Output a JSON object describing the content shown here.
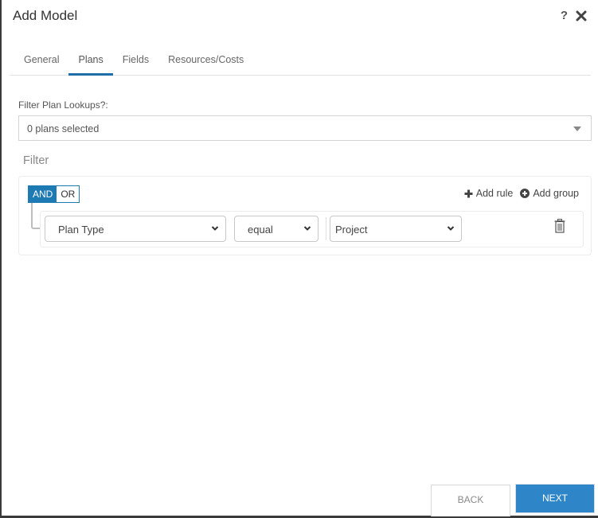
{
  "dialog": {
    "title": "Add Model",
    "help_label": "?",
    "close_icon": "close-icon"
  },
  "tabs": [
    {
      "label": "General",
      "active": false
    },
    {
      "label": "Plans",
      "active": true
    },
    {
      "label": "Fields",
      "active": false
    },
    {
      "label": "Resources/Costs",
      "active": false
    }
  ],
  "lookup": {
    "label": "Filter Plan Lookups?:",
    "value": "0 plans selected"
  },
  "filter": {
    "heading": "Filter",
    "conditions": [
      {
        "label": "AND",
        "active": true
      },
      {
        "label": "OR",
        "active": false
      }
    ],
    "add_rule_label": "Add rule",
    "add_group_label": "Add group",
    "rules": [
      {
        "field": "Plan Type",
        "operator": "equal",
        "value": "Project"
      }
    ]
  },
  "footer": {
    "back_label": "BACK",
    "next_label": "NEXT"
  },
  "colors": {
    "accent": "#1e7ab3",
    "next_button": "#2e86c8",
    "tab_underline": "#1e6fa8"
  }
}
